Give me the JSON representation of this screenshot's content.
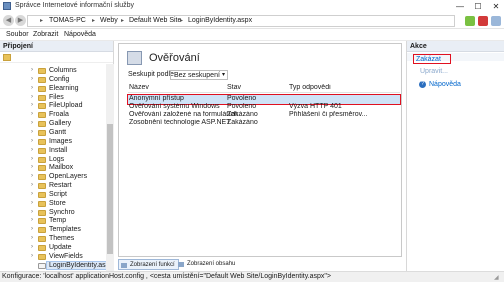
{
  "window": {
    "title": "Správce Internetové informační služby",
    "min_label": "—",
    "max_label": "☐",
    "close_label": "✕"
  },
  "address": {
    "crumbs": [
      "TOMAS-PC",
      "Weby",
      "Default Web Site",
      "LoginByIdentity.aspx"
    ],
    "sep": "▸",
    "back": "◀",
    "forward": "▶"
  },
  "menu": [
    "Soubor",
    "Zobrazit",
    "Nápověda"
  ],
  "left": {
    "header": "Připojení",
    "tree": [
      "Columns",
      "Config",
      "Elearning",
      "Files",
      "FileUpload",
      "Froala",
      "Gallery",
      "Gantt",
      "Images",
      "Install",
      "Logs",
      "Mailbox",
      "OpenLayers",
      "Restart",
      "Script",
      "Store",
      "Synchro",
      "Temp",
      "Templates",
      "Themes",
      "Update",
      "ViewFields",
      "LoginByIdentity.aspx"
    ],
    "expander": "›"
  },
  "center": {
    "title": "Ověřování",
    "group_label": "Seskupit podle:",
    "group_value": "Bez seskupení",
    "columns": [
      "Název",
      "Stav",
      "Typ odpovědi"
    ],
    "rows": [
      [
        "Anonymní přístup",
        "Povoleno",
        ""
      ],
      [
        "Ověřování systému Windows",
        "Povoleno",
        "Výzva HTTP 401"
      ],
      [
        "Ověřování založené na formulářích",
        "Zakázáno",
        "Přihlášení či přesměrov..."
      ],
      [
        "Zosobnění technologie ASP.NET",
        "Zakázáno",
        ""
      ]
    ],
    "tabs": [
      "Zobrazení funkcí",
      "Zobrazení obsahu"
    ]
  },
  "right": {
    "header": "Akce",
    "actions": {
      "enable": "Zakázat",
      "edit": "Upravit...",
      "help": "Nápověda"
    }
  },
  "status": {
    "text": "Konfigurace: 'localhost' applicationHost.config , <cesta umístění=\"Default Web Site/LoginByIdentity.aspx\">"
  },
  "colors": {
    "accent": "#0066cc",
    "highlight": "#e01020",
    "selection": "#cfe3f7"
  }
}
